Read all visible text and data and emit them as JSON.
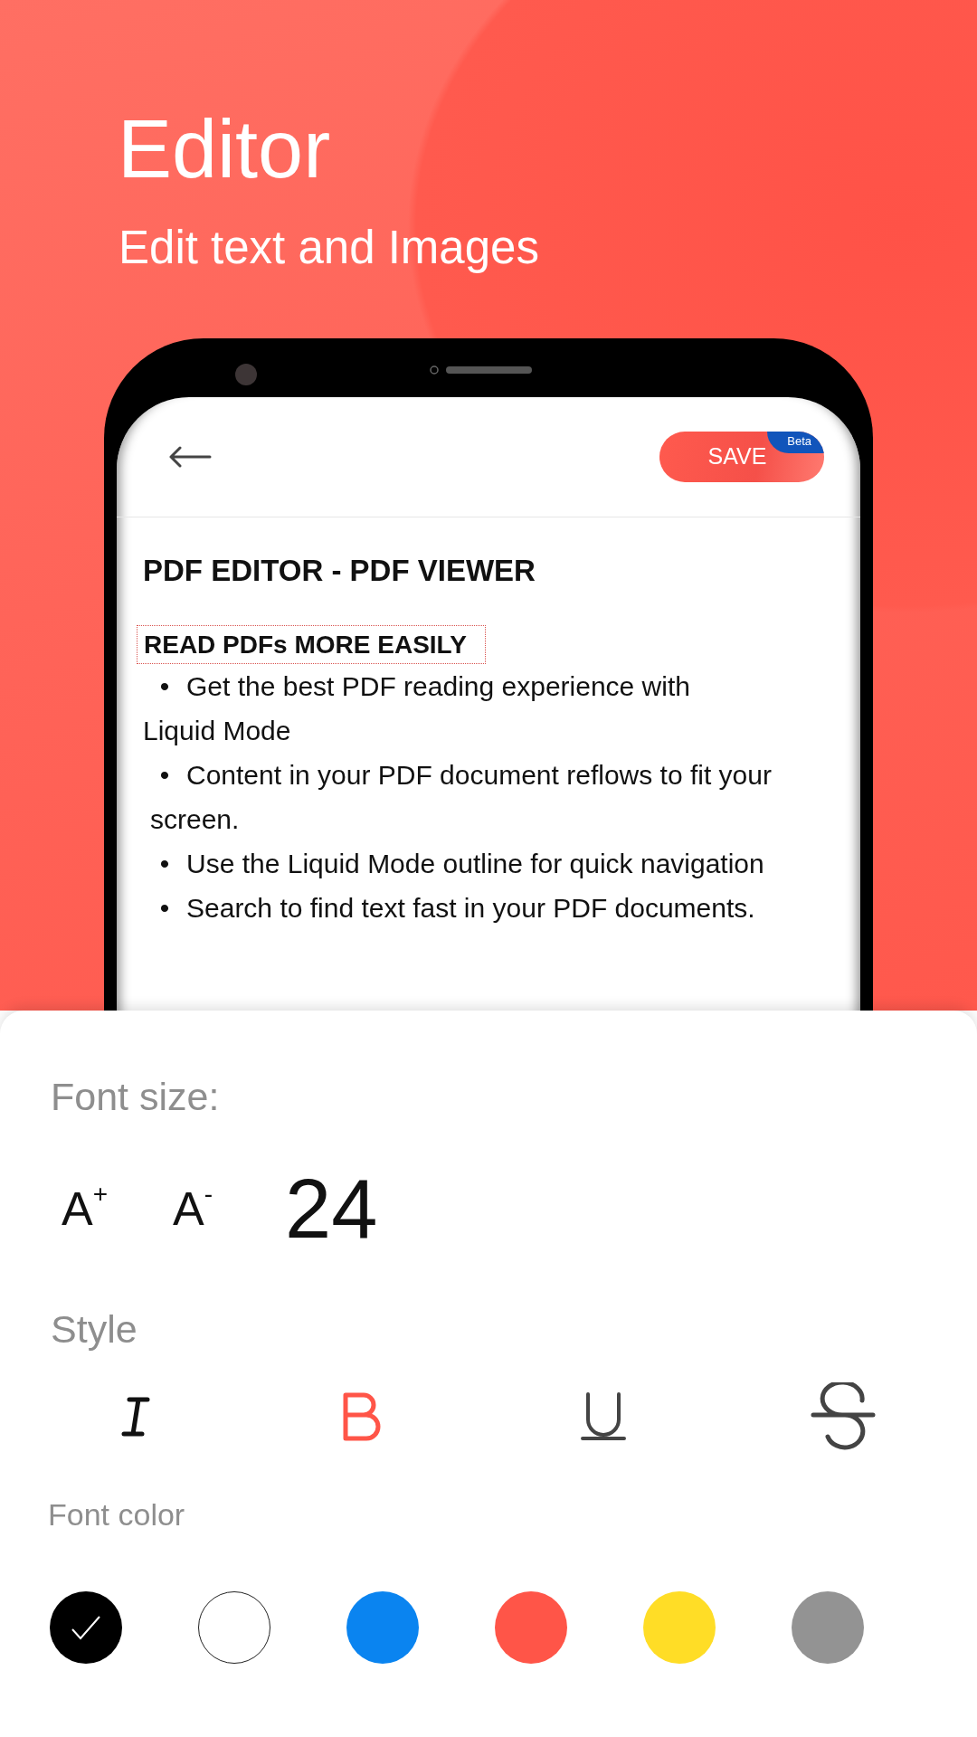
{
  "hero": {
    "title": "Editor",
    "subtitle": "Edit text and Images"
  },
  "editor": {
    "save_label": "SAVE",
    "badge": "Beta",
    "doc_title": "PDF EDITOR - PDF VIEWER",
    "selected_heading": "READ PDFs MORE EASILY",
    "lines": [
      {
        "bullet": "•",
        "text": "Get the best PDF reading experience with"
      },
      {
        "text": "Liquid Mode"
      },
      {
        "bullet": "•",
        "text": "Content in your PDF document reflows to fit your"
      },
      {
        "text": "screen.",
        "indent": true
      },
      {
        "bullet": "•",
        "text": "Use the Liquid Mode outline for quick navigation"
      },
      {
        "bullet": "•",
        "text": "Search to find text fast in your PDF documents."
      }
    ]
  },
  "sheet": {
    "font_size_label": "Font size:",
    "size_buttons": [
      "A$^{+}$",
      "A$^{-}$"
    ],
    "font_size": "24",
    "style_label": "Style",
    "styles": [
      {
        "kind": "italic",
        "selected": false
      },
      {
        "kind": "bold",
        "selected": true
      },
      {
        "kind": "underline",
        "selected": false
      },
      {
        "kind": "strikethrough",
        "selected": false
      }
    ],
    "font_color_label": "Font color",
    "colors": [
      {
        "color": "#000000",
        "selected": true
      },
      {
        "color": "#ffffff",
        "selected": false
      },
      {
        "color": "#0a84f0",
        "selected": false
      },
      {
        "color": "#ff5548",
        "selected": false
      },
      {
        "color": "#ffdd26",
        "selected": false
      },
      {
        "color": "#939393",
        "selected": false
      }
    ]
  }
}
